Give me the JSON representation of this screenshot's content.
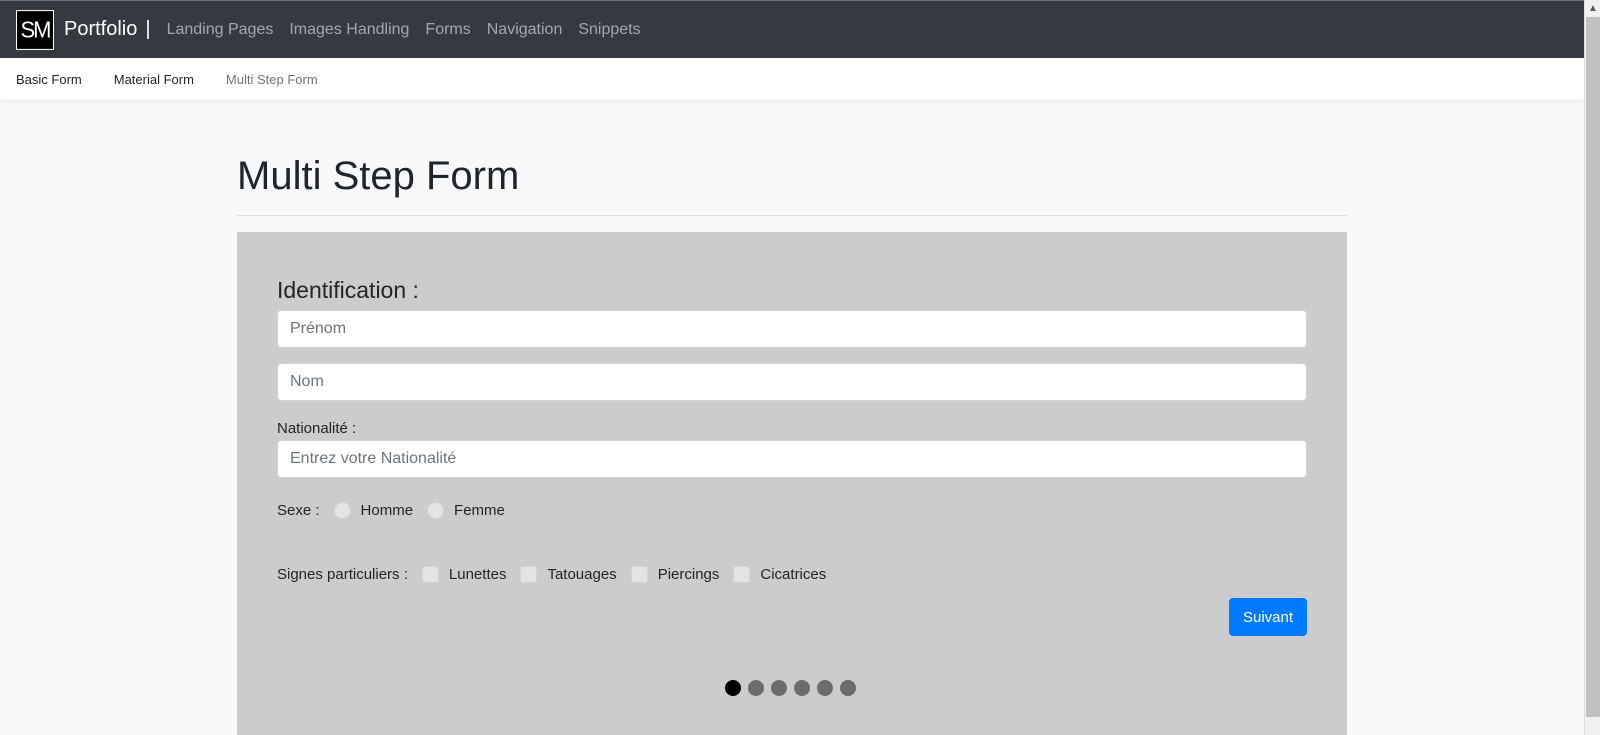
{
  "navbar": {
    "logo_text": "SM",
    "brand": "Portfolio",
    "separator": "|",
    "links": [
      "Landing Pages",
      "Images Handling",
      "Forms",
      "Navigation",
      "Snippets"
    ]
  },
  "subnav": {
    "links": [
      "Basic Form",
      "Material Form",
      "Multi Step Form"
    ],
    "active": "Multi Step Form"
  },
  "page": {
    "title": "Multi Step Form"
  },
  "form": {
    "section_title": "Identification :",
    "first_name_placeholder": "Prénom",
    "last_name_placeholder": "Nom",
    "nationality_label": "Nationalité :",
    "nationality_placeholder": "Entrez votre Nationalité",
    "sex_label": "Sexe :",
    "sex_options": [
      "Homme",
      "Femme"
    ],
    "marks_label": "Signes particuliers :",
    "marks_options": [
      "Lunettes",
      "Tatouages",
      "Piercings",
      "Cicatrices"
    ],
    "next_button": "Suivant"
  },
  "steps": {
    "total": 6,
    "current": 1
  },
  "colors": {
    "navbar": "#343a40",
    "card": "#cccccc",
    "primary": "#007bff"
  }
}
